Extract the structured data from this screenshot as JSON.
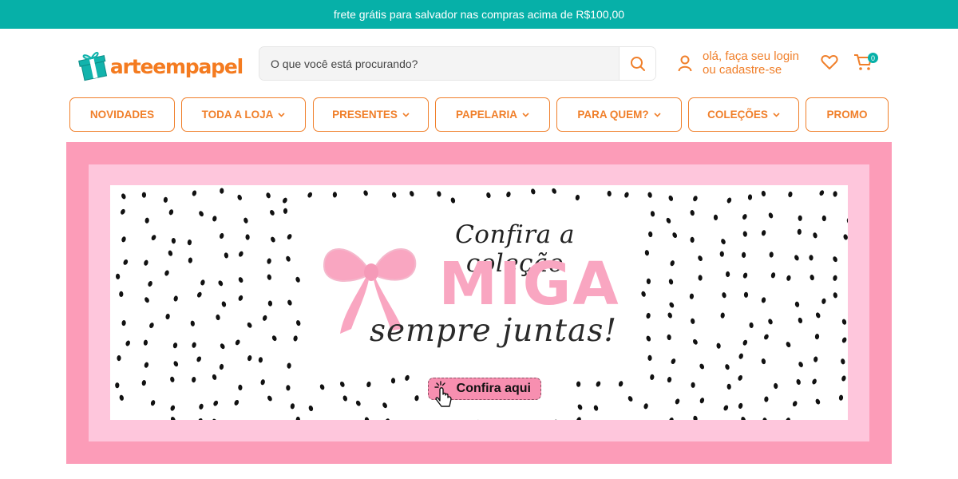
{
  "topbar": {
    "message": "frete grátis para salvador nas compras acima de R$100,00"
  },
  "brand": {
    "name": "arteempapel",
    "accent": "#f07f2a",
    "teal": "#06b0a8"
  },
  "search": {
    "placeholder": "O que você está procurando?",
    "value": "",
    "icon": "search-icon"
  },
  "account": {
    "line1": "olá, faça seu login",
    "line2": "ou cadastre-se",
    "icon": "user-icon"
  },
  "wishlist": {
    "icon": "heart-icon"
  },
  "cart": {
    "icon": "cart-icon",
    "count": "0"
  },
  "nav": [
    {
      "label": "NOVIDADES",
      "dropdown": false
    },
    {
      "label": "TODA A LOJA",
      "dropdown": true
    },
    {
      "label": "PRESENTES",
      "dropdown": true
    },
    {
      "label": "PAPELARIA",
      "dropdown": true
    },
    {
      "label": "PARA QUEM?",
      "dropdown": true
    },
    {
      "label": "COLEÇÕES",
      "dropdown": true
    },
    {
      "label": "PROMO",
      "dropdown": false
    }
  ],
  "banner": {
    "line1": "Confira a coleção",
    "line2": "MIGA",
    "line3": "sempre juntas!",
    "cta": "Confira aqui",
    "colors": {
      "outer": "#fc9cb8",
      "mid": "#fec6dc",
      "bow": "#f9a6c1"
    }
  }
}
